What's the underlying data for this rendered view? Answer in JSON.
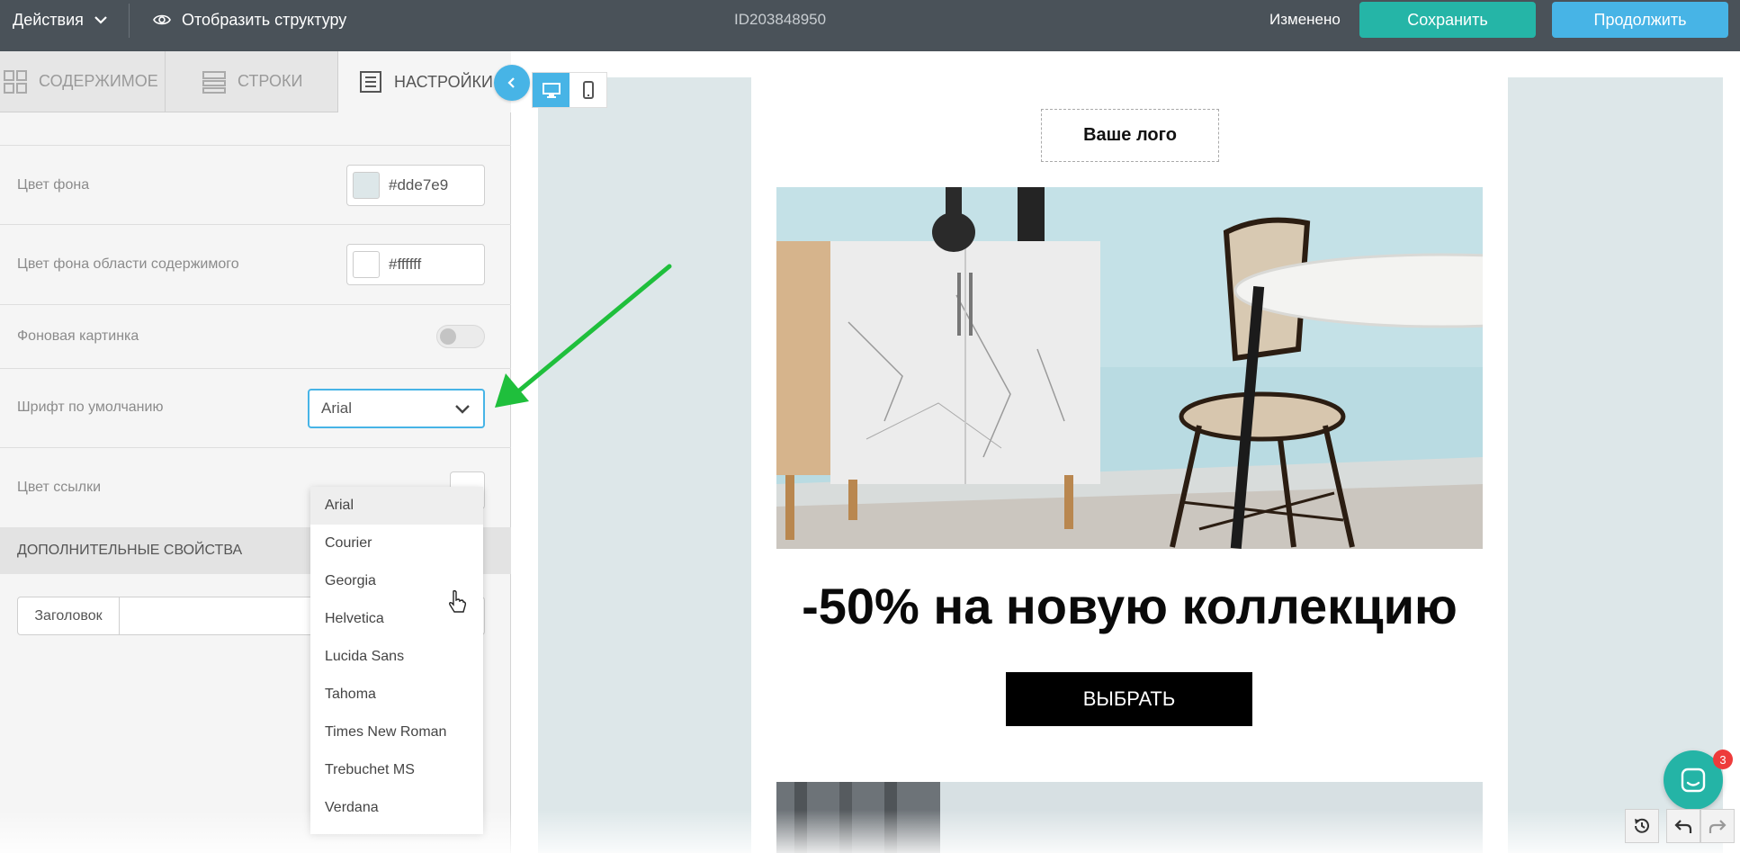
{
  "topbar": {
    "actions_label": "Действия",
    "structure_label": "Отобразить структуру",
    "document_id": "ID203848950",
    "status": "Изменено",
    "save_label": "Сохранить",
    "continue_label": "Продолжить"
  },
  "sidebar": {
    "tabs": [
      {
        "label": "СОДЕРЖИМОЕ",
        "icon": "grid-icon"
      },
      {
        "label": "СТРОКИ",
        "icon": "rows-icon"
      },
      {
        "label": "НАСТРОЙКИ",
        "icon": "document-icon",
        "active": true
      }
    ],
    "settings": {
      "bg_color_label": "Цвет фона",
      "bg_color_value": "#dde7e9",
      "content_bg_label": "Цвет фона области содержимого",
      "content_bg_value": "#ffffff",
      "bg_image_label": "Фоновая картинка",
      "bg_image_enabled": false,
      "default_font_label": "Шрифт по умолчанию",
      "default_font_value": "Arial",
      "link_color_label": "Цвет ссылки"
    },
    "extra_section_title": "ДОПОЛНИТЕЛЬНЫЕ СВОЙСТВА",
    "title_tag_label": "Заголовок",
    "font_options": [
      "Arial",
      "Courier",
      "Georgia",
      "Helvetica",
      "Lucida Sans",
      "Tahoma",
      "Times New Roman",
      "Trebuchet MS",
      "Verdana"
    ],
    "highlighted_option": "Arial"
  },
  "email": {
    "logo_placeholder": "Ваше лого",
    "headline": "-50% на новую коллекцию",
    "cta_label": "ВЫБРАТЬ"
  },
  "chat_badge": "3",
  "colors": {
    "topbar": "#4a5259",
    "save": "#25b5a7",
    "continue": "#47b4e6",
    "canvas_bg": "#dde7e9",
    "annotation_arrow": "#1fbf3c"
  }
}
